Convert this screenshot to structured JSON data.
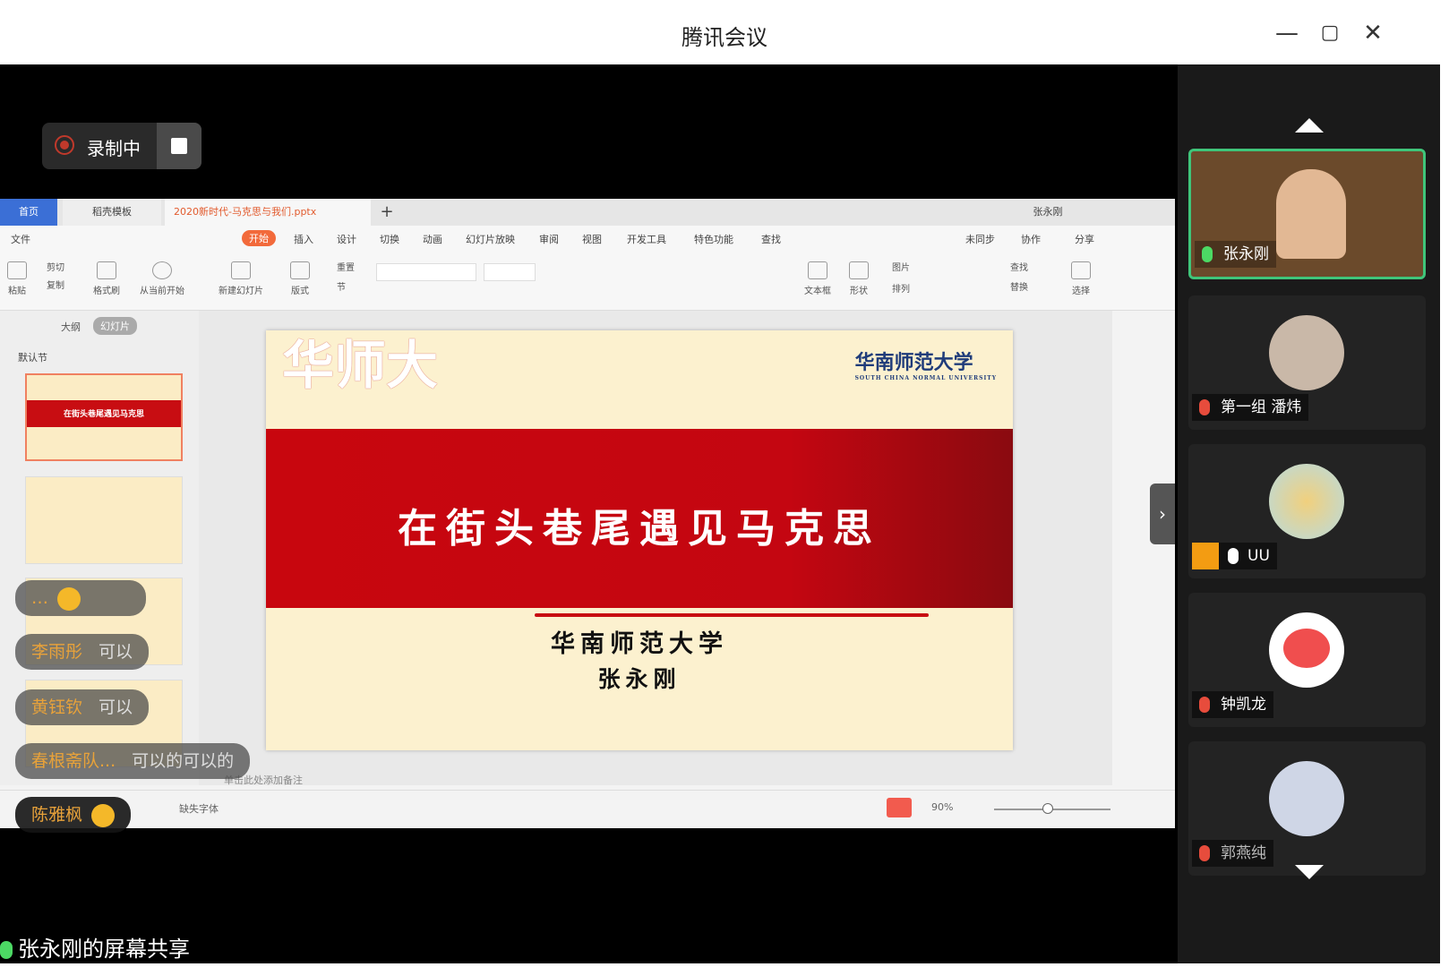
{
  "window": {
    "title": "腾讯会议"
  },
  "recording": {
    "label": "录制中"
  },
  "wps": {
    "tabs": {
      "home": "首页",
      "template": "稻壳模板",
      "document": "2020新时代-马克思与我们.pptx",
      "user": "张永刚"
    },
    "menu": [
      "文件",
      "开始",
      "插入",
      "设计",
      "切换",
      "动画",
      "幻灯片放映",
      "审阅",
      "视图",
      "开发工具",
      "特色功能",
      "查找"
    ],
    "menu_right": [
      "未同步",
      "协作",
      "分享"
    ],
    "ribbon": [
      "粘贴",
      "剪切",
      "复制",
      "格式刷",
      "从当前开始",
      "新建幻灯片",
      "版式",
      "重置",
      "节",
      "文本框",
      "形状",
      "排列",
      "图片",
      "查找",
      "替换",
      "选择"
    ],
    "panel_tabs": [
      "大纲",
      "幻灯片"
    ],
    "section_label": "默认节",
    "thumb_title": "在街头巷尾遇见马克思",
    "notes_placeholder": "单击此处添加备注",
    "status_font": "缺失字体",
    "zoom": "90%"
  },
  "slide": {
    "calligraphy": "华师大",
    "logo_text": "华南师范大学",
    "logo_sub": "SOUTH CHINA NORMAL UNIVERSITY",
    "headline": "在街头巷尾遇见马克思",
    "university": "华南师范大学",
    "author": "张永刚"
  },
  "chat": [
    {
      "name": "…",
      "message": ""
    },
    {
      "name": "李雨彤",
      "message": "可以"
    },
    {
      "name": "黄钰钦",
      "message": "可以"
    },
    {
      "name": "春根斋队...",
      "message": "可以的可以的"
    },
    {
      "name": "陈雅枫",
      "message": ""
    }
  ],
  "share_label": "张永刚的屏幕共享",
  "participants": [
    {
      "name": "张永刚",
      "mic": "on"
    },
    {
      "name": "第一组 潘炜",
      "mic": "muted"
    },
    {
      "name": "UU",
      "mic": "on"
    },
    {
      "name": "钟凯龙",
      "mic": "muted"
    },
    {
      "name": "郭燕纯",
      "mic": "muted"
    }
  ]
}
